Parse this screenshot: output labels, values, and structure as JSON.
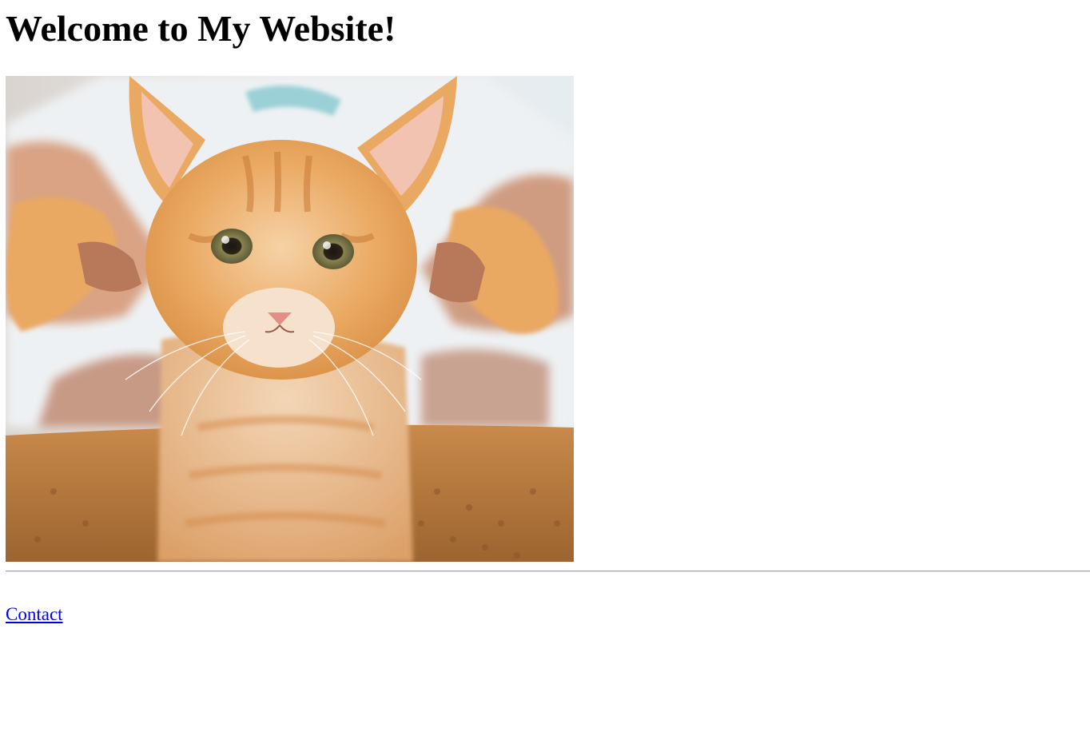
{
  "page": {
    "heading": "Welcome to My Website!",
    "image": {
      "subject": "orange tabby kitten held up by a person's hands",
      "icon": "kitten-photo"
    },
    "footer": {
      "contact_link": "Contact"
    }
  },
  "colors": {
    "background": "#ffffff",
    "text": "#000000",
    "link": "#0000ee",
    "divider": "#9a9a9a",
    "kitten_fur": "#e9a45c",
    "basket": "#b0733a",
    "shirt": "#e8eef2"
  }
}
